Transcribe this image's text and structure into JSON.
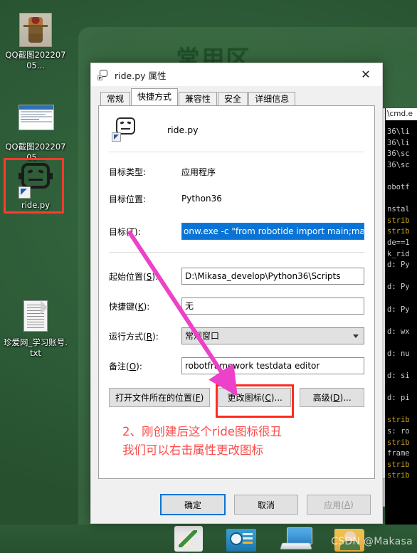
{
  "desktop": {
    "background_color": "#2e5f3a",
    "panel_title": "常用区",
    "icons": [
      {
        "label": "QQ截图20220705...",
        "icon": "image-thumbnail-robot-icon"
      },
      {
        "label": "QQ截图20220705...",
        "icon": "image-thumbnail-window-icon"
      },
      {
        "label": "ride.py",
        "icon": "robot-face-shortcut-icon",
        "selected": true
      },
      {
        "label": "珍爱网_学习账号.txt",
        "icon": "text-file-icon"
      }
    ]
  },
  "console": {
    "title": "\\cmd.e",
    "lines": [
      {
        "text": "36\\li",
        "color": "#cccccc"
      },
      {
        "text": "36\\li",
        "color": "#cccccc"
      },
      {
        "text": "36\\sc",
        "color": "#cccccc"
      },
      {
        "text": "36\\sc",
        "color": "#cccccc"
      },
      {
        "text": "",
        "color": "#cccccc"
      },
      {
        "text": "obotf",
        "color": "#cccccc"
      },
      {
        "text": "",
        "color": "#cccccc"
      },
      {
        "text": "nstal",
        "color": "#cccccc"
      },
      {
        "text": "strib",
        "color": "#c8a31e"
      },
      {
        "text": "strib",
        "color": "#c8a31e"
      },
      {
        "text": "de==1",
        "color": "#cccccc"
      },
      {
        "text": "k_rid",
        "color": "#cccccc"
      },
      {
        "text": "d: Py",
        "color": "#cccccc"
      },
      {
        "text": "",
        "color": "#cccccc"
      },
      {
        "text": "d: Py",
        "color": "#cccccc"
      },
      {
        "text": "",
        "color": "#cccccc"
      },
      {
        "text": "d: Py",
        "color": "#cccccc"
      },
      {
        "text": "",
        "color": "#cccccc"
      },
      {
        "text": "d: wx",
        "color": "#cccccc"
      },
      {
        "text": "",
        "color": "#cccccc"
      },
      {
        "text": "d: nu",
        "color": "#cccccc"
      },
      {
        "text": "",
        "color": "#cccccc"
      },
      {
        "text": "d: si",
        "color": "#cccccc"
      },
      {
        "text": "",
        "color": "#cccccc"
      },
      {
        "text": "d: pi",
        "color": "#cccccc"
      },
      {
        "text": "",
        "color": "#cccccc"
      },
      {
        "text": "strib",
        "color": "#c8a31e"
      },
      {
        "text": "s: ro",
        "color": "#cccccc"
      },
      {
        "text": "strib",
        "color": "#c8a31e"
      },
      {
        "text": "frame",
        "color": "#cccccc"
      },
      {
        "text": "strib",
        "color": "#c8a31e"
      },
      {
        "text": "strib",
        "color": "#c8a31e"
      }
    ]
  },
  "dialog": {
    "title": "ride.py 属性",
    "close_label": "✕",
    "tabs": [
      {
        "label": "常规",
        "active": false
      },
      {
        "label": "快捷方式",
        "active": true
      },
      {
        "label": "兼容性",
        "active": false
      },
      {
        "label": "安全",
        "active": false
      },
      {
        "label": "详细信息",
        "active": false
      }
    ],
    "header_name": "ride.py",
    "fields": [
      {
        "label": "目标类型:",
        "value": "应用程序",
        "kind": "static"
      },
      {
        "label": "目标位置:",
        "value": "Python36",
        "kind": "static"
      },
      {
        "label": "目标(T):",
        "value": "onw.exe -c \"from robotide import main;main()\"",
        "kind": "input-selected"
      },
      {
        "label": "起始位置(S):",
        "value": "D:\\Mikasa_develop\\Python36\\Scripts",
        "kind": "input"
      },
      {
        "label": "快捷键(K):",
        "value": "无",
        "kind": "input"
      },
      {
        "label": "运行方式(R):",
        "value": "常规窗口",
        "kind": "select"
      },
      {
        "label": "备注(O):",
        "value": "robotframework testdata editor",
        "kind": "input"
      }
    ],
    "action_buttons": [
      {
        "label": "打开文件所在的位置(F)",
        "highlighted": false
      },
      {
        "label": "更改图标(C)...",
        "highlighted": true
      },
      {
        "label": "高级(D)...",
        "highlighted": false
      }
    ],
    "footer_buttons": [
      {
        "label": "确定",
        "style": "primary"
      },
      {
        "label": "取消",
        "style": "normal"
      },
      {
        "label": "应用(A)",
        "style": "disabled"
      }
    ]
  },
  "annotation": {
    "color": "#fb4b4b",
    "arrow_color": "#ec41c8",
    "line1": "2、刚创建后这个ride图标很丑",
    "line2": "我们可以右击属性更改图标"
  },
  "taskbar": {
    "items": [
      "broom-icon",
      "media-player-icon",
      "this-pc-icon",
      "folder-user-icon"
    ],
    "watermark": "CSDN @Makasa"
  }
}
